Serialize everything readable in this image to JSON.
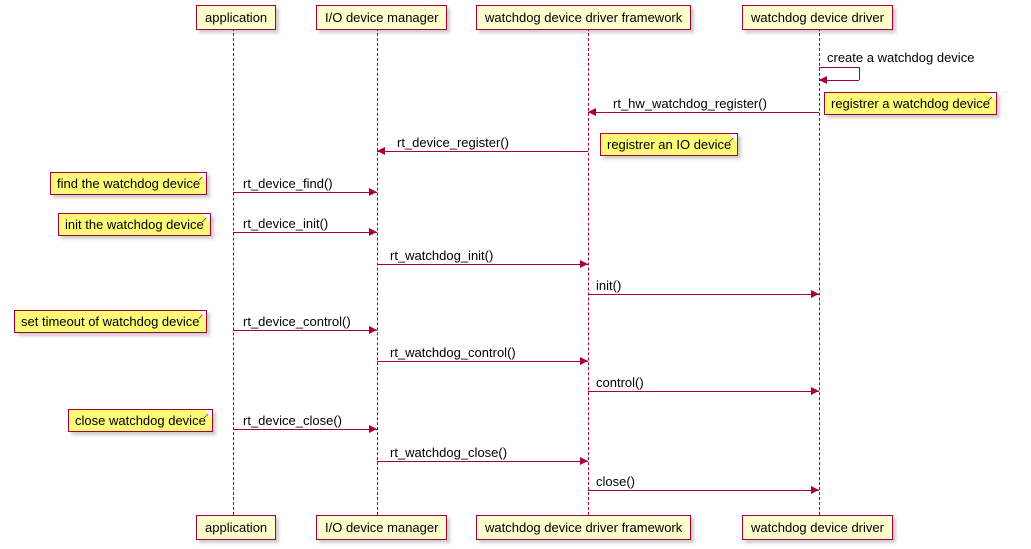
{
  "participants": {
    "app": "application",
    "io": "I/O device manager",
    "fw": "watchdog device driver framework",
    "drv": "watchdog device driver"
  },
  "notes": {
    "create": "create a watchdog device",
    "reg_wd": "registrer a watchdog device",
    "reg_io": "registrer an IO device",
    "find": "find the watchdog device",
    "init": "init the watchdog device",
    "timeout": "set timeout of watchdog device",
    "close": "close watchdog device"
  },
  "messages": {
    "m1": "rt_hw_watchdog_register()",
    "m2": "rt_device_register()",
    "m3": "rt_device_find()",
    "m4": "rt_device_init()",
    "m5": "rt_watchdog_init()",
    "m6": "init()",
    "m7": "rt_device_control()",
    "m8": "rt_watchdog_control()",
    "m9": "control()",
    "m10": "rt_device_close()",
    "m11": "rt_watchdog_close()",
    "m12": "close()"
  }
}
